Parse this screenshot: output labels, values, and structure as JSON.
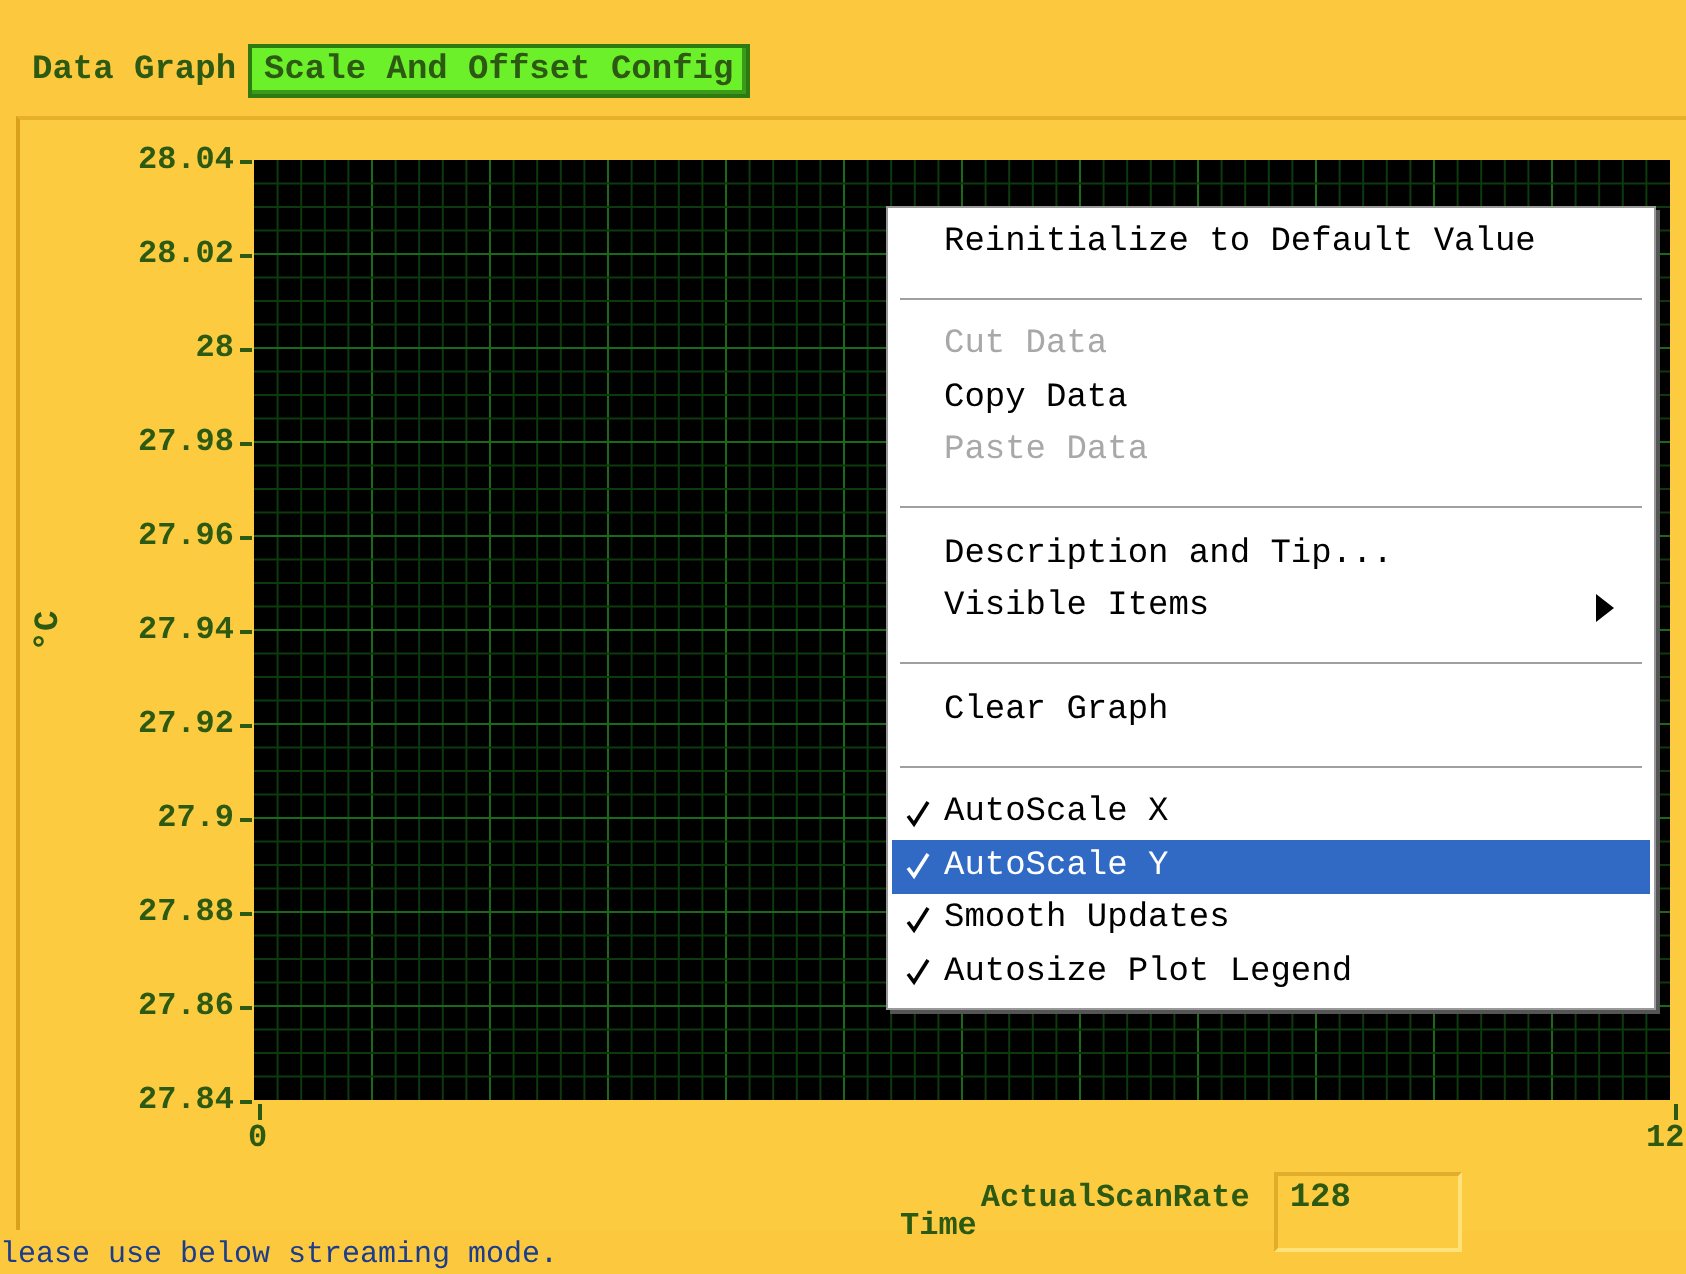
{
  "tabs": [
    {
      "label": "Data Graph",
      "selected": true
    },
    {
      "label": "Scale And Offset Config",
      "selected": false
    }
  ],
  "graph": {
    "y_axis": {
      "label": "°C",
      "ticks": [
        "28.04",
        "28.02",
        "28",
        "27.98",
        "27.96",
        "27.94",
        "27.92",
        "27.9",
        "27.88",
        "27.86",
        "27.84"
      ]
    },
    "x_axis": {
      "label": "Time",
      "ticks": [
        "0",
        "12"
      ]
    }
  },
  "context_menu": [
    {
      "kind": "item",
      "label": "Reinitialize to Default Value",
      "disabled": false,
      "checked": false,
      "selected": false
    },
    {
      "kind": "separator"
    },
    {
      "kind": "item",
      "label": "Cut Data",
      "disabled": true,
      "checked": false,
      "selected": false
    },
    {
      "kind": "item",
      "label": "Copy Data",
      "disabled": false,
      "checked": false,
      "selected": false
    },
    {
      "kind": "item",
      "label": "Paste Data",
      "disabled": true,
      "checked": false,
      "selected": false
    },
    {
      "kind": "separator"
    },
    {
      "kind": "item",
      "label": "Description and Tip...",
      "disabled": false,
      "checked": false,
      "selected": false
    },
    {
      "kind": "submenu",
      "label": "Visible Items",
      "disabled": false,
      "checked": false,
      "selected": false
    },
    {
      "kind": "separator"
    },
    {
      "kind": "item",
      "label": "Clear Graph",
      "disabled": false,
      "checked": false,
      "selected": false
    },
    {
      "kind": "separator"
    },
    {
      "kind": "item",
      "label": "AutoScale X",
      "disabled": false,
      "checked": true,
      "selected": false
    },
    {
      "kind": "item",
      "label": "AutoScale Y",
      "disabled": false,
      "checked": true,
      "selected": true
    },
    {
      "kind": "item",
      "label": "Smooth Updates",
      "disabled": false,
      "checked": true,
      "selected": false
    },
    {
      "kind": "item",
      "label": "Autosize Plot Legend",
      "disabled": false,
      "checked": true,
      "selected": false
    }
  ],
  "scan_rate": {
    "label": "ActualScanRate",
    "value": "128"
  },
  "status_text": "lease use below streaming mode."
}
